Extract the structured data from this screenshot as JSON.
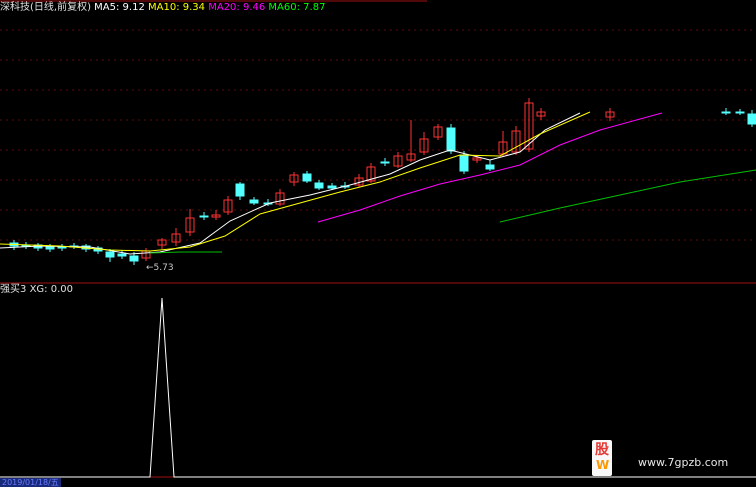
{
  "header": {
    "title": "深科技(日线,前复权)",
    "ma5": "MA5: 9.12",
    "ma10": "MA10: 9.34",
    "ma20": "MA20: 9.46",
    "ma60": "MA60: 7.87"
  },
  "indicator": {
    "label": "强买3",
    "xg": "XG: 0.00"
  },
  "low_label": "←5.73",
  "date_label": "2019/01/18/五",
  "watermark": {
    "glyph_top": "股",
    "glyph_bottom": "W",
    "url": "www.7gpzb.com"
  },
  "colors": {
    "background": "#000000",
    "up": "#ff3232",
    "down": "#54ffff",
    "frame": "#a01010",
    "ma5": "#ffffff",
    "ma10": "#ffff00",
    "ma20": "#ff00ff",
    "ma60": "#00c000"
  }
}
